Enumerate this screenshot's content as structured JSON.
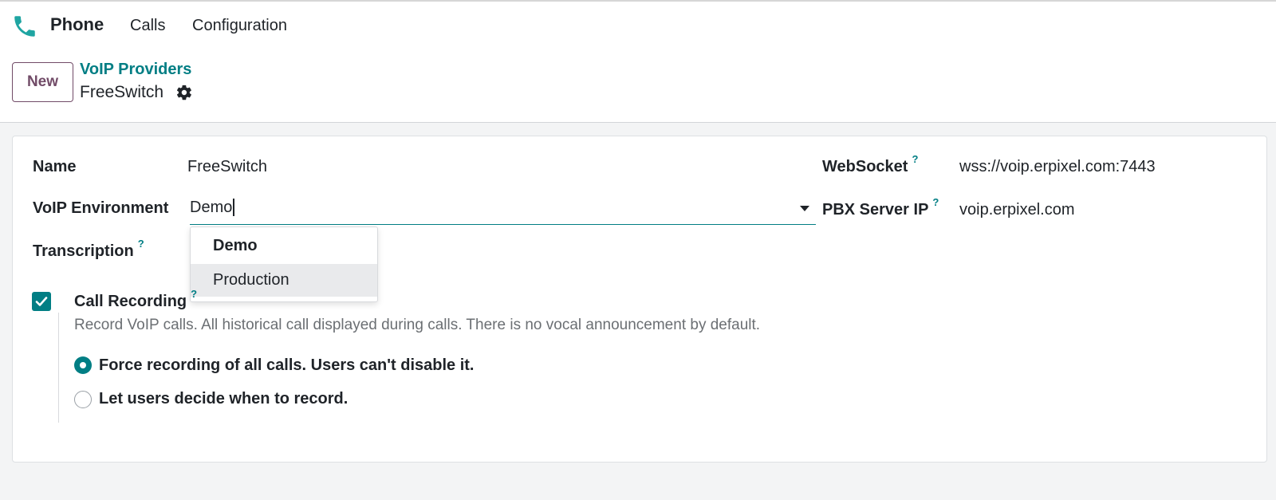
{
  "app": {
    "name": "Phone",
    "icon": "phone-icon",
    "accent_color": "#017e84",
    "brand_color": "#714b67"
  },
  "menu": {
    "items": [
      "Calls",
      "Configuration"
    ]
  },
  "control": {
    "new_label": "New",
    "breadcrumb": {
      "parent": "VoIP Providers",
      "current": "FreeSwitch",
      "actions_icon": "gear-icon"
    }
  },
  "form": {
    "name": {
      "label": "Name",
      "value": "FreeSwitch"
    },
    "environment": {
      "label": "VoIP Environment",
      "value": "Demo",
      "options": [
        "Demo",
        "Production"
      ],
      "highlighted_option": "Production"
    },
    "transcription": {
      "label": "Transcription",
      "help": "?"
    },
    "websocket": {
      "label": "WebSocket",
      "help": "?",
      "value": "wss://voip.erpixel.com:7443"
    },
    "pbx": {
      "label": "PBX Server IP",
      "help": "?",
      "value": "voip.erpixel.com"
    },
    "call_recording": {
      "label": "Call Recording",
      "help": "?",
      "checked": true,
      "description": "Record VoIP calls. All historical call displayed during calls. There is no vocal announcement by default.",
      "options": [
        {
          "label": "Force recording of all calls. Users can't disable it.",
          "selected": true
        },
        {
          "label": "Let users decide when to record.",
          "selected": false
        }
      ]
    }
  }
}
